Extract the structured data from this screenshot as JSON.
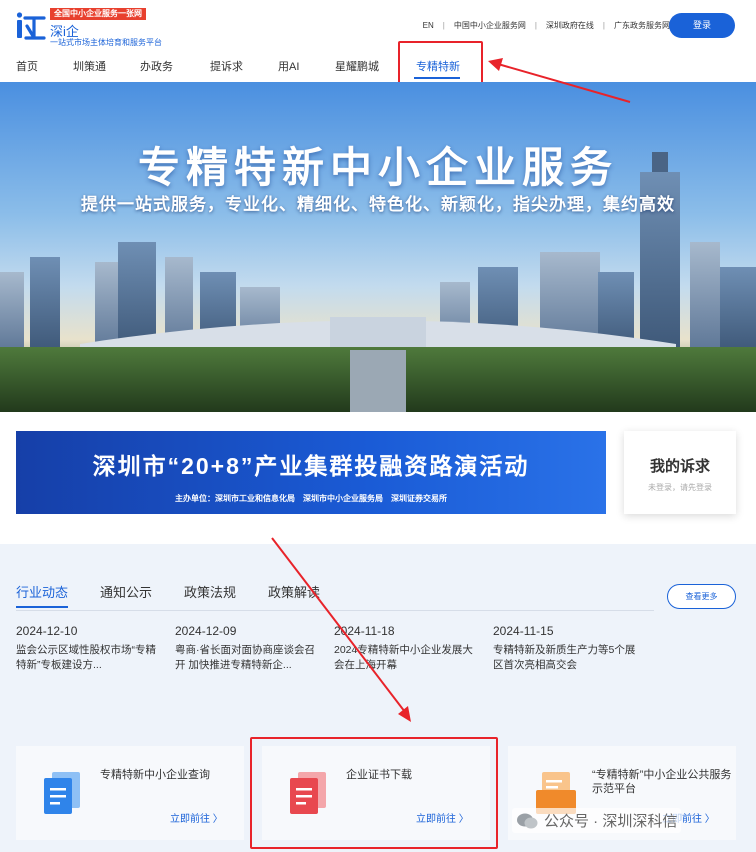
{
  "colors": {
    "brand": "#1a62d8",
    "highlight": "#e8232a",
    "slogan_bg": "#e8402e"
  },
  "logo": {
    "slogan": "全国中小企业服务一张网",
    "name": "深i企",
    "sub": "一站式市场主体培育和服务平台"
  },
  "toplinks": [
    "EN",
    "中国中小企业服务网",
    "深圳政府在线",
    "广东政务服务网"
  ],
  "login_label": "登录",
  "nav": [
    "首页",
    "圳策通",
    "办政务",
    "提诉求",
    "用AI",
    "星耀鹏城",
    "专精特新"
  ],
  "banner": {
    "title": "专精特新中小企业服务",
    "subtitle": "提供一站式服务，专业化、精细化、特色化、新颖化，指尖办理，集约高效"
  },
  "promo": {
    "title": "深圳市“20+8”产业集群投融资路演活动",
    "sub": "主办单位：深圳市工业和信息化局　深圳市中小企业服务局　深圳证券交易所"
  },
  "appeal": {
    "title": "我的诉求",
    "sub": "未登录，请先登录"
  },
  "news": {
    "tabs": [
      "行业动态",
      "通知公示",
      "政策法规",
      "政策解读"
    ],
    "more": "查看更多",
    "items": [
      {
        "date": "2024-12-10",
        "text": "监会公示区域性股权市场“专精特新”专板建设方..."
      },
      {
        "date": "2024-12-09",
        "text": "粤商·省长面对面协商座谈会召开 加快推进专精特新企..."
      },
      {
        "date": "2024-11-18",
        "text": "2024专精特新中小企业发展大会在上海开幕"
      },
      {
        "date": "2024-11-15",
        "text": "专精特新及新质生产力等5个展区首次亮相高交会"
      }
    ]
  },
  "services": [
    {
      "title": "专精特新中小企业查询",
      "link": "立即前往 〉",
      "icon": "blue-doc-icon"
    },
    {
      "title": "企业证书下载",
      "link": "立即前往 〉",
      "icon": "red-doc-icon"
    },
    {
      "title": "“专精特新”中小企业公共服务示范平台",
      "link": "立即前往 〉",
      "icon": "orange-doc-icon"
    }
  ],
  "watermark": "公众号 · 深圳深科信"
}
